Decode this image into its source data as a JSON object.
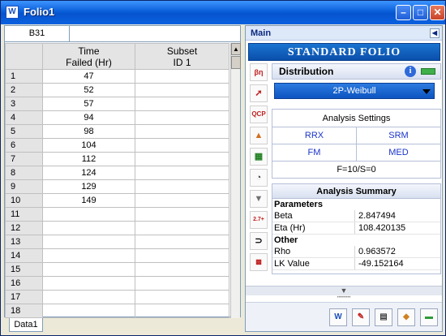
{
  "window": {
    "title": "Folio1",
    "app_icon": "W"
  },
  "sheet": {
    "name_box": "B31",
    "formula": "",
    "columns": [
      "Time\nFailed (Hr)",
      "Subset\nID 1"
    ],
    "rows": [
      {
        "n": "1",
        "a": "47",
        "b": ""
      },
      {
        "n": "2",
        "a": "52",
        "b": ""
      },
      {
        "n": "3",
        "a": "57",
        "b": ""
      },
      {
        "n": "4",
        "a": "94",
        "b": ""
      },
      {
        "n": "5",
        "a": "98",
        "b": ""
      },
      {
        "n": "6",
        "a": "104",
        "b": ""
      },
      {
        "n": "7",
        "a": "112",
        "b": ""
      },
      {
        "n": "8",
        "a": "124",
        "b": ""
      },
      {
        "n": "9",
        "a": "129",
        "b": ""
      },
      {
        "n": "10",
        "a": "149",
        "b": ""
      },
      {
        "n": "11",
        "a": "",
        "b": ""
      },
      {
        "n": "12",
        "a": "",
        "b": ""
      },
      {
        "n": "13",
        "a": "",
        "b": ""
      },
      {
        "n": "14",
        "a": "",
        "b": ""
      },
      {
        "n": "15",
        "a": "",
        "b": ""
      },
      {
        "n": "16",
        "a": "",
        "b": ""
      },
      {
        "n": "17",
        "a": "",
        "b": ""
      },
      {
        "n": "18",
        "a": "",
        "b": ""
      }
    ],
    "tab": "Data1"
  },
  "panel": {
    "header": "Main",
    "banner": "Standard Folio",
    "distribution_label": "Distribution",
    "distribution_value": "2P-Weibull",
    "settings_title": "Analysis Settings",
    "settings": {
      "rrx": "RRX",
      "srm": "SRM",
      "fm": "FM",
      "med": "MED",
      "footer": "F=10/S=0"
    },
    "summary_title": "Analysis Summary",
    "parameters_label": "Parameters",
    "beta_label": "Beta",
    "beta_value": "2.847494",
    "eta_label": "Eta (Hr)",
    "eta_value": "108.420135",
    "other_label": "Other",
    "rho_label": "Rho",
    "rho_value": "0.963572",
    "lk_label": "LK Value",
    "lk_value": "-49.152164"
  }
}
